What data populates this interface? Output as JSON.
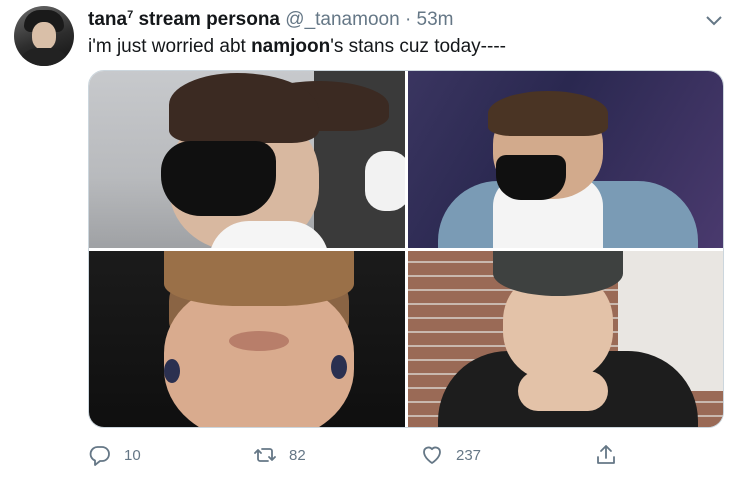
{
  "tweet": {
    "display_name": "tana",
    "name_superscript": "7",
    "name_suffix": " stream persona",
    "handle": "@_tanamoon",
    "separator": "·",
    "time": "53m",
    "text_before": "i'm just worried abt ",
    "text_bold": "namjoon",
    "text_after": "'s stans  cuz today----"
  },
  "actions": {
    "replies": "10",
    "retweets": "82",
    "likes": "237"
  },
  "colors": {
    "text_primary": "#14171a",
    "text_secondary": "#657786",
    "border": "#ccd6dd"
  },
  "icons": {
    "reply": "reply-icon",
    "retweet": "retweet-icon",
    "like": "heart-icon",
    "share": "share-icon",
    "more": "chevron-down-icon"
  }
}
